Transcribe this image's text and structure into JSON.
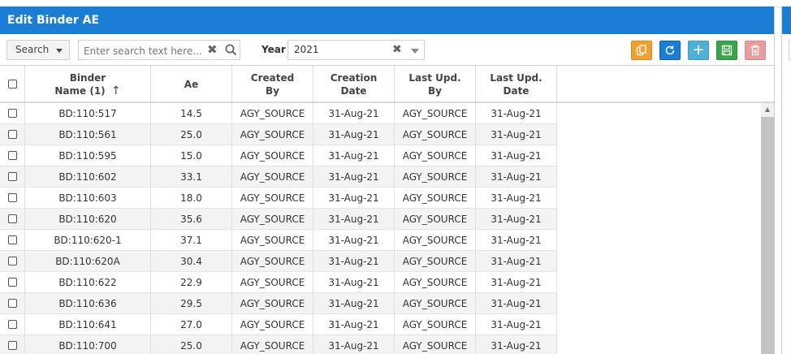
{
  "window": {
    "title": "Edit Binder AE"
  },
  "toolbar": {
    "search_mode": "Search",
    "search_placeholder": "Enter search text here...",
    "year_label": "Year",
    "year_value": "2021",
    "buttons": [
      {
        "name": "copy",
        "icon": "copy-icon",
        "color": "#f0a030"
      },
      {
        "name": "refresh",
        "icon": "refresh-icon",
        "color": "#1a7fd4"
      },
      {
        "name": "add",
        "icon": "plus-icon",
        "color": "#4fb0d6"
      },
      {
        "name": "save",
        "icon": "save-icon",
        "color": "#3aa54a"
      },
      {
        "name": "delete",
        "icon": "trash-icon",
        "color": "#e89c9c"
      }
    ]
  },
  "grid": {
    "columns": [
      {
        "line1": "Binder",
        "line2": "Name (1)",
        "sort": "↑"
      },
      {
        "line1": "Ae",
        "line2": ""
      },
      {
        "line1": "Created",
        "line2": "By"
      },
      {
        "line1": "Creation",
        "line2": "Date"
      },
      {
        "line1": "Last Upd.",
        "line2": "By"
      },
      {
        "line1": "Last Upd.",
        "line2": "Date"
      }
    ],
    "rows": [
      {
        "name": "BD:110:517",
        "ae": "14.5",
        "created_by": "AGY_SOURCE",
        "creation_date": "31-Aug-21",
        "upd_by": "AGY_SOURCE",
        "upd_date": "31-Aug-21"
      },
      {
        "name": "BD:110:561",
        "ae": "25.0",
        "created_by": "AGY_SOURCE",
        "creation_date": "31-Aug-21",
        "upd_by": "AGY_SOURCE",
        "upd_date": "31-Aug-21"
      },
      {
        "name": "BD:110:595",
        "ae": "15.0",
        "created_by": "AGY_SOURCE",
        "creation_date": "31-Aug-21",
        "upd_by": "AGY_SOURCE",
        "upd_date": "31-Aug-21"
      },
      {
        "name": "BD:110:602",
        "ae": "33.1",
        "created_by": "AGY_SOURCE",
        "creation_date": "31-Aug-21",
        "upd_by": "AGY_SOURCE",
        "upd_date": "31-Aug-21"
      },
      {
        "name": "BD:110:603",
        "ae": "18.0",
        "created_by": "AGY_SOURCE",
        "creation_date": "31-Aug-21",
        "upd_by": "AGY_SOURCE",
        "upd_date": "31-Aug-21"
      },
      {
        "name": "BD:110:620",
        "ae": "35.6",
        "created_by": "AGY_SOURCE",
        "creation_date": "31-Aug-21",
        "upd_by": "AGY_SOURCE",
        "upd_date": "31-Aug-21"
      },
      {
        "name": "BD:110:620-1",
        "ae": "37.1",
        "created_by": "AGY_SOURCE",
        "creation_date": "31-Aug-21",
        "upd_by": "AGY_SOURCE",
        "upd_date": "31-Aug-21"
      },
      {
        "name": "BD:110:620A",
        "ae": "30.4",
        "created_by": "AGY_SOURCE",
        "creation_date": "31-Aug-21",
        "upd_by": "AGY_SOURCE",
        "upd_date": "31-Aug-21"
      },
      {
        "name": "BD:110:622",
        "ae": "22.9",
        "created_by": "AGY_SOURCE",
        "creation_date": "31-Aug-21",
        "upd_by": "AGY_SOURCE",
        "upd_date": "31-Aug-21"
      },
      {
        "name": "BD:110:636",
        "ae": "29.5",
        "created_by": "AGY_SOURCE",
        "creation_date": "31-Aug-21",
        "upd_by": "AGY_SOURCE",
        "upd_date": "31-Aug-21"
      },
      {
        "name": "BD:110:641",
        "ae": "27.0",
        "created_by": "AGY_SOURCE",
        "creation_date": "31-Aug-21",
        "upd_by": "AGY_SOURCE",
        "upd_date": "31-Aug-21"
      },
      {
        "name": "BD:110:700",
        "ae": "25.0",
        "created_by": "AGY_SOURCE",
        "creation_date": "31-Aug-21",
        "upd_by": "AGY_SOURCE",
        "upd_date": "31-Aug-21"
      }
    ]
  }
}
